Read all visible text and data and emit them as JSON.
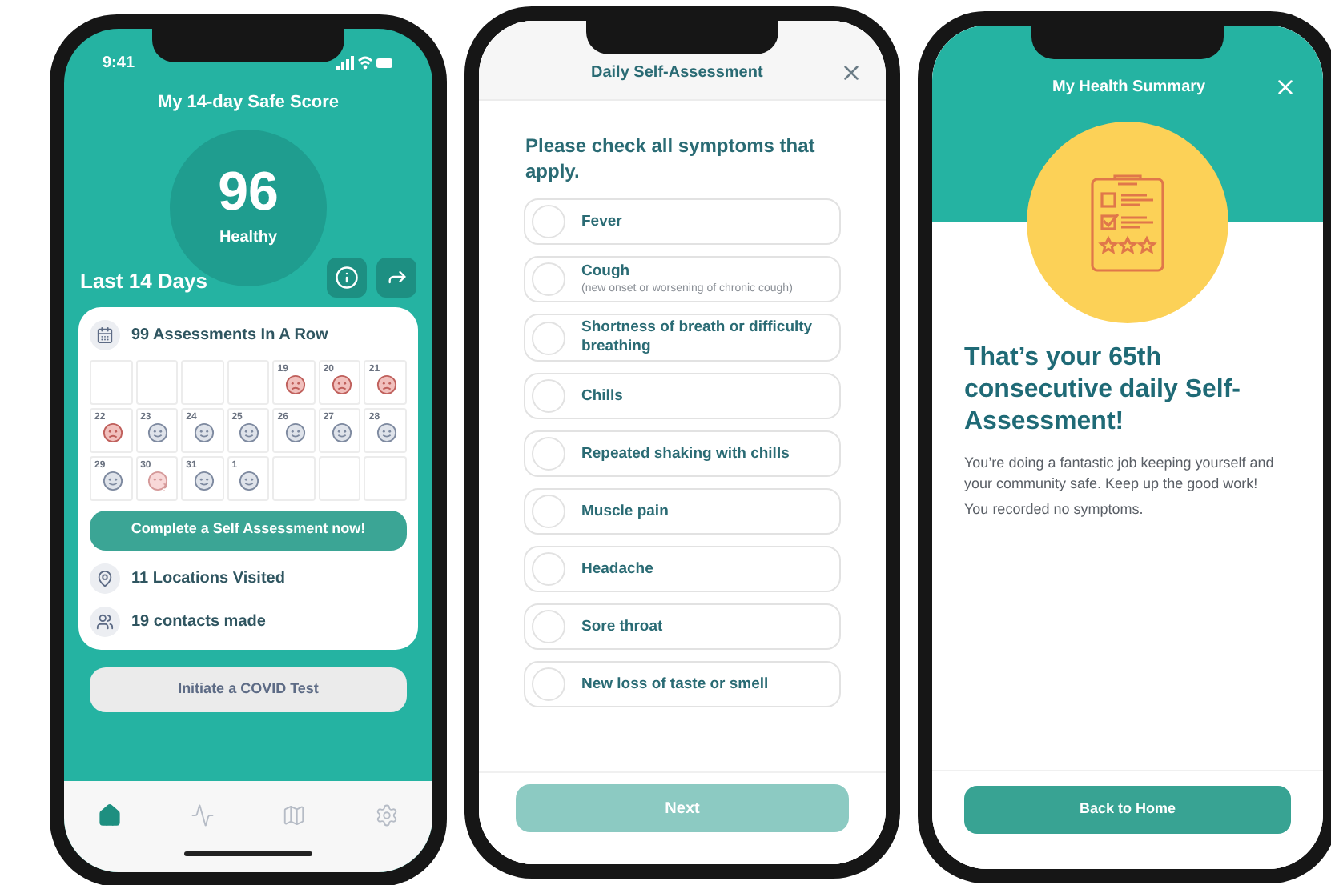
{
  "home_screen": {
    "status_time": "9:41",
    "title": "My 14-day Safe Score",
    "score": "96",
    "score_label": "Healthy",
    "section_title": "Last 14 Days",
    "streak": "99 Assessments In A Row",
    "calendar": [
      {
        "kind": "empty"
      },
      {
        "kind": "empty"
      },
      {
        "kind": "empty"
      },
      {
        "kind": "empty"
      },
      {
        "kind": "sad",
        "day": "19"
      },
      {
        "kind": "sad",
        "day": "20"
      },
      {
        "kind": "sad",
        "day": "21"
      },
      {
        "kind": "sad",
        "day": "22"
      },
      {
        "kind": "ok",
        "day": "23"
      },
      {
        "kind": "ok",
        "day": "24"
      },
      {
        "kind": "ok",
        "day": "25"
      },
      {
        "kind": "ok",
        "day": "26"
      },
      {
        "kind": "ok",
        "day": "27"
      },
      {
        "kind": "ok",
        "day": "28"
      },
      {
        "kind": "ok",
        "day": "29"
      },
      {
        "kind": "unsure",
        "day": "30"
      },
      {
        "kind": "ok",
        "day": "31"
      },
      {
        "kind": "ok",
        "day": "1"
      },
      {
        "kind": "empty"
      },
      {
        "kind": "empty"
      },
      {
        "kind": "empty"
      }
    ],
    "cta": "Complete a Self Assessment now!",
    "stats": [
      {
        "kind": "locations",
        "label": "11 Locations Visited"
      },
      {
        "kind": "contacts",
        "label": "19 contacts made"
      }
    ],
    "test_button": "Initiate a COVID Test",
    "nav": [
      {
        "kind": "home",
        "selected": true
      },
      {
        "kind": "activity",
        "selected": false
      },
      {
        "kind": "map",
        "selected": false
      },
      {
        "kind": "settings",
        "selected": false
      }
    ]
  },
  "assessment_screen": {
    "title": "Daily Self-Assessment",
    "question": "Please check all symptoms that apply.",
    "symptoms": [
      {
        "label": "Fever",
        "checked": false
      },
      {
        "label": "Cough",
        "note": "(new onset or worsening of chronic cough)",
        "checked": false
      },
      {
        "label": "Shortness of breath or difficulty breathing",
        "checked": false
      },
      {
        "label": "Chills",
        "checked": false
      },
      {
        "label": "Repeated shaking with chills",
        "checked": false
      },
      {
        "label": "Muscle pain",
        "checked": false
      },
      {
        "label": "Headache",
        "checked": false
      },
      {
        "label": "Sore throat",
        "checked": false
      },
      {
        "label": "New loss of taste or smell",
        "checked": false
      }
    ],
    "next_button": "Next"
  },
  "summary_screen": {
    "title": "My Health Summary",
    "headline": "That’s your 65th consecutive daily Self-Assessment!",
    "message": "You’re doing a fantastic job keeping yourself and your community safe. Keep up the good work!",
    "note": "You recorded no symptoms.",
    "button": "Back to Home"
  }
}
